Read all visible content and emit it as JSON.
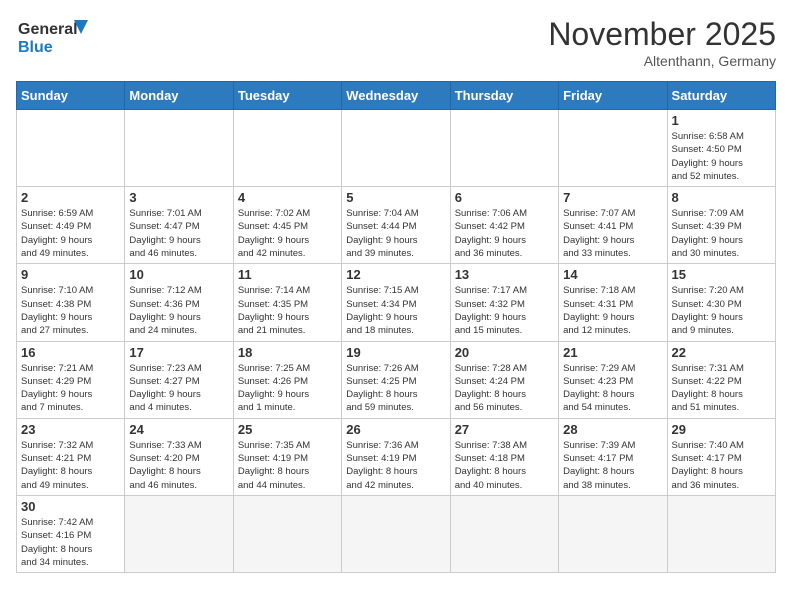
{
  "logo": {
    "text_general": "General",
    "text_blue": "Blue"
  },
  "header": {
    "month_year": "November 2025",
    "location": "Altenthann, Germany"
  },
  "weekdays": [
    "Sunday",
    "Monday",
    "Tuesday",
    "Wednesday",
    "Thursday",
    "Friday",
    "Saturday"
  ],
  "weeks": [
    [
      {
        "day": "",
        "info": ""
      },
      {
        "day": "",
        "info": ""
      },
      {
        "day": "",
        "info": ""
      },
      {
        "day": "",
        "info": ""
      },
      {
        "day": "",
        "info": ""
      },
      {
        "day": "",
        "info": ""
      },
      {
        "day": "1",
        "info": "Sunrise: 6:58 AM\nSunset: 4:50 PM\nDaylight: 9 hours\nand 52 minutes."
      }
    ],
    [
      {
        "day": "2",
        "info": "Sunrise: 6:59 AM\nSunset: 4:49 PM\nDaylight: 9 hours\nand 49 minutes."
      },
      {
        "day": "3",
        "info": "Sunrise: 7:01 AM\nSunset: 4:47 PM\nDaylight: 9 hours\nand 46 minutes."
      },
      {
        "day": "4",
        "info": "Sunrise: 7:02 AM\nSunset: 4:45 PM\nDaylight: 9 hours\nand 42 minutes."
      },
      {
        "day": "5",
        "info": "Sunrise: 7:04 AM\nSunset: 4:44 PM\nDaylight: 9 hours\nand 39 minutes."
      },
      {
        "day": "6",
        "info": "Sunrise: 7:06 AM\nSunset: 4:42 PM\nDaylight: 9 hours\nand 36 minutes."
      },
      {
        "day": "7",
        "info": "Sunrise: 7:07 AM\nSunset: 4:41 PM\nDaylight: 9 hours\nand 33 minutes."
      },
      {
        "day": "8",
        "info": "Sunrise: 7:09 AM\nSunset: 4:39 PM\nDaylight: 9 hours\nand 30 minutes."
      }
    ],
    [
      {
        "day": "9",
        "info": "Sunrise: 7:10 AM\nSunset: 4:38 PM\nDaylight: 9 hours\nand 27 minutes."
      },
      {
        "day": "10",
        "info": "Sunrise: 7:12 AM\nSunset: 4:36 PM\nDaylight: 9 hours\nand 24 minutes."
      },
      {
        "day": "11",
        "info": "Sunrise: 7:14 AM\nSunset: 4:35 PM\nDaylight: 9 hours\nand 21 minutes."
      },
      {
        "day": "12",
        "info": "Sunrise: 7:15 AM\nSunset: 4:34 PM\nDaylight: 9 hours\nand 18 minutes."
      },
      {
        "day": "13",
        "info": "Sunrise: 7:17 AM\nSunset: 4:32 PM\nDaylight: 9 hours\nand 15 minutes."
      },
      {
        "day": "14",
        "info": "Sunrise: 7:18 AM\nSunset: 4:31 PM\nDaylight: 9 hours\nand 12 minutes."
      },
      {
        "day": "15",
        "info": "Sunrise: 7:20 AM\nSunset: 4:30 PM\nDaylight: 9 hours\nand 9 minutes."
      }
    ],
    [
      {
        "day": "16",
        "info": "Sunrise: 7:21 AM\nSunset: 4:29 PM\nDaylight: 9 hours\nand 7 minutes."
      },
      {
        "day": "17",
        "info": "Sunrise: 7:23 AM\nSunset: 4:27 PM\nDaylight: 9 hours\nand 4 minutes."
      },
      {
        "day": "18",
        "info": "Sunrise: 7:25 AM\nSunset: 4:26 PM\nDaylight: 9 hours\nand 1 minute."
      },
      {
        "day": "19",
        "info": "Sunrise: 7:26 AM\nSunset: 4:25 PM\nDaylight: 8 hours\nand 59 minutes."
      },
      {
        "day": "20",
        "info": "Sunrise: 7:28 AM\nSunset: 4:24 PM\nDaylight: 8 hours\nand 56 minutes."
      },
      {
        "day": "21",
        "info": "Sunrise: 7:29 AM\nSunset: 4:23 PM\nDaylight: 8 hours\nand 54 minutes."
      },
      {
        "day": "22",
        "info": "Sunrise: 7:31 AM\nSunset: 4:22 PM\nDaylight: 8 hours\nand 51 minutes."
      }
    ],
    [
      {
        "day": "23",
        "info": "Sunrise: 7:32 AM\nSunset: 4:21 PM\nDaylight: 8 hours\nand 49 minutes."
      },
      {
        "day": "24",
        "info": "Sunrise: 7:33 AM\nSunset: 4:20 PM\nDaylight: 8 hours\nand 46 minutes."
      },
      {
        "day": "25",
        "info": "Sunrise: 7:35 AM\nSunset: 4:19 PM\nDaylight: 8 hours\nand 44 minutes."
      },
      {
        "day": "26",
        "info": "Sunrise: 7:36 AM\nSunset: 4:19 PM\nDaylight: 8 hours\nand 42 minutes."
      },
      {
        "day": "27",
        "info": "Sunrise: 7:38 AM\nSunset: 4:18 PM\nDaylight: 8 hours\nand 40 minutes."
      },
      {
        "day": "28",
        "info": "Sunrise: 7:39 AM\nSunset: 4:17 PM\nDaylight: 8 hours\nand 38 minutes."
      },
      {
        "day": "29",
        "info": "Sunrise: 7:40 AM\nSunset: 4:17 PM\nDaylight: 8 hours\nand 36 minutes."
      }
    ],
    [
      {
        "day": "30",
        "info": "Sunrise: 7:42 AM\nSunset: 4:16 PM\nDaylight: 8 hours\nand 34 minutes."
      },
      {
        "day": "",
        "info": ""
      },
      {
        "day": "",
        "info": ""
      },
      {
        "day": "",
        "info": ""
      },
      {
        "day": "",
        "info": ""
      },
      {
        "day": "",
        "info": ""
      },
      {
        "day": "",
        "info": ""
      }
    ]
  ]
}
